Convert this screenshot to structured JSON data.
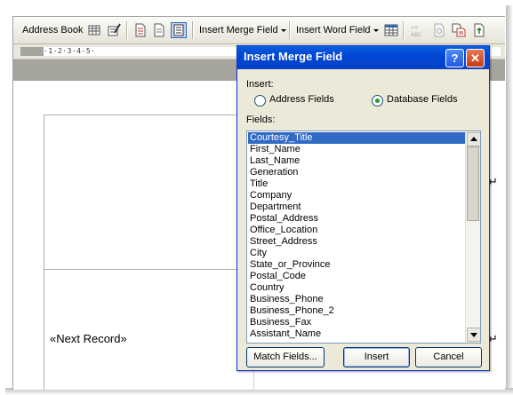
{
  "toolbar": {
    "address_book": "Address Book",
    "insert_merge_field": "Insert Merge Field",
    "insert_word_field": "Insert Word Field",
    "icons": [
      "view-list-icon",
      "edit-recipients-icon",
      "document-icon",
      "document-icon",
      "highlight-fields-icon",
      "table-icon",
      "view-merged-data-icon",
      "check-errors-icon",
      "merge-to-document-icon",
      "merge-to-printer-icon"
    ]
  },
  "ruler": {
    "text": "·1·2·3·4·5·"
  },
  "document": {
    "next_record": "«Next Record»",
    "pilcrow": "↵"
  },
  "dialog": {
    "title": "Insert Merge Field",
    "help_glyph": "?",
    "close_glyph": "✕",
    "insert_label": "Insert:",
    "radio_address": "Address Fields",
    "radio_database": "Database Fields",
    "selected_radio": "Database Fields",
    "fields_label": "Fields:",
    "fields": [
      "Courtesy_Title",
      "First_Name",
      "Last_Name",
      "Generation",
      "Title",
      "Company",
      "Department",
      "Postal_Address",
      "Office_Location",
      "Street_Address",
      "City",
      "State_or_Province",
      "Postal_Code",
      "Country",
      "Business_Phone",
      "Business_Phone_2",
      "Business_Fax",
      "Assistant_Name"
    ],
    "selected_field": "Courtesy_Title",
    "match_fields": "Match Fields...",
    "insert_button": "Insert",
    "cancel_button": "Cancel"
  },
  "colors": {
    "titlebar": "#0a5fde",
    "selection": "#316ac5",
    "dialog_bg": "#ece9d8"
  }
}
